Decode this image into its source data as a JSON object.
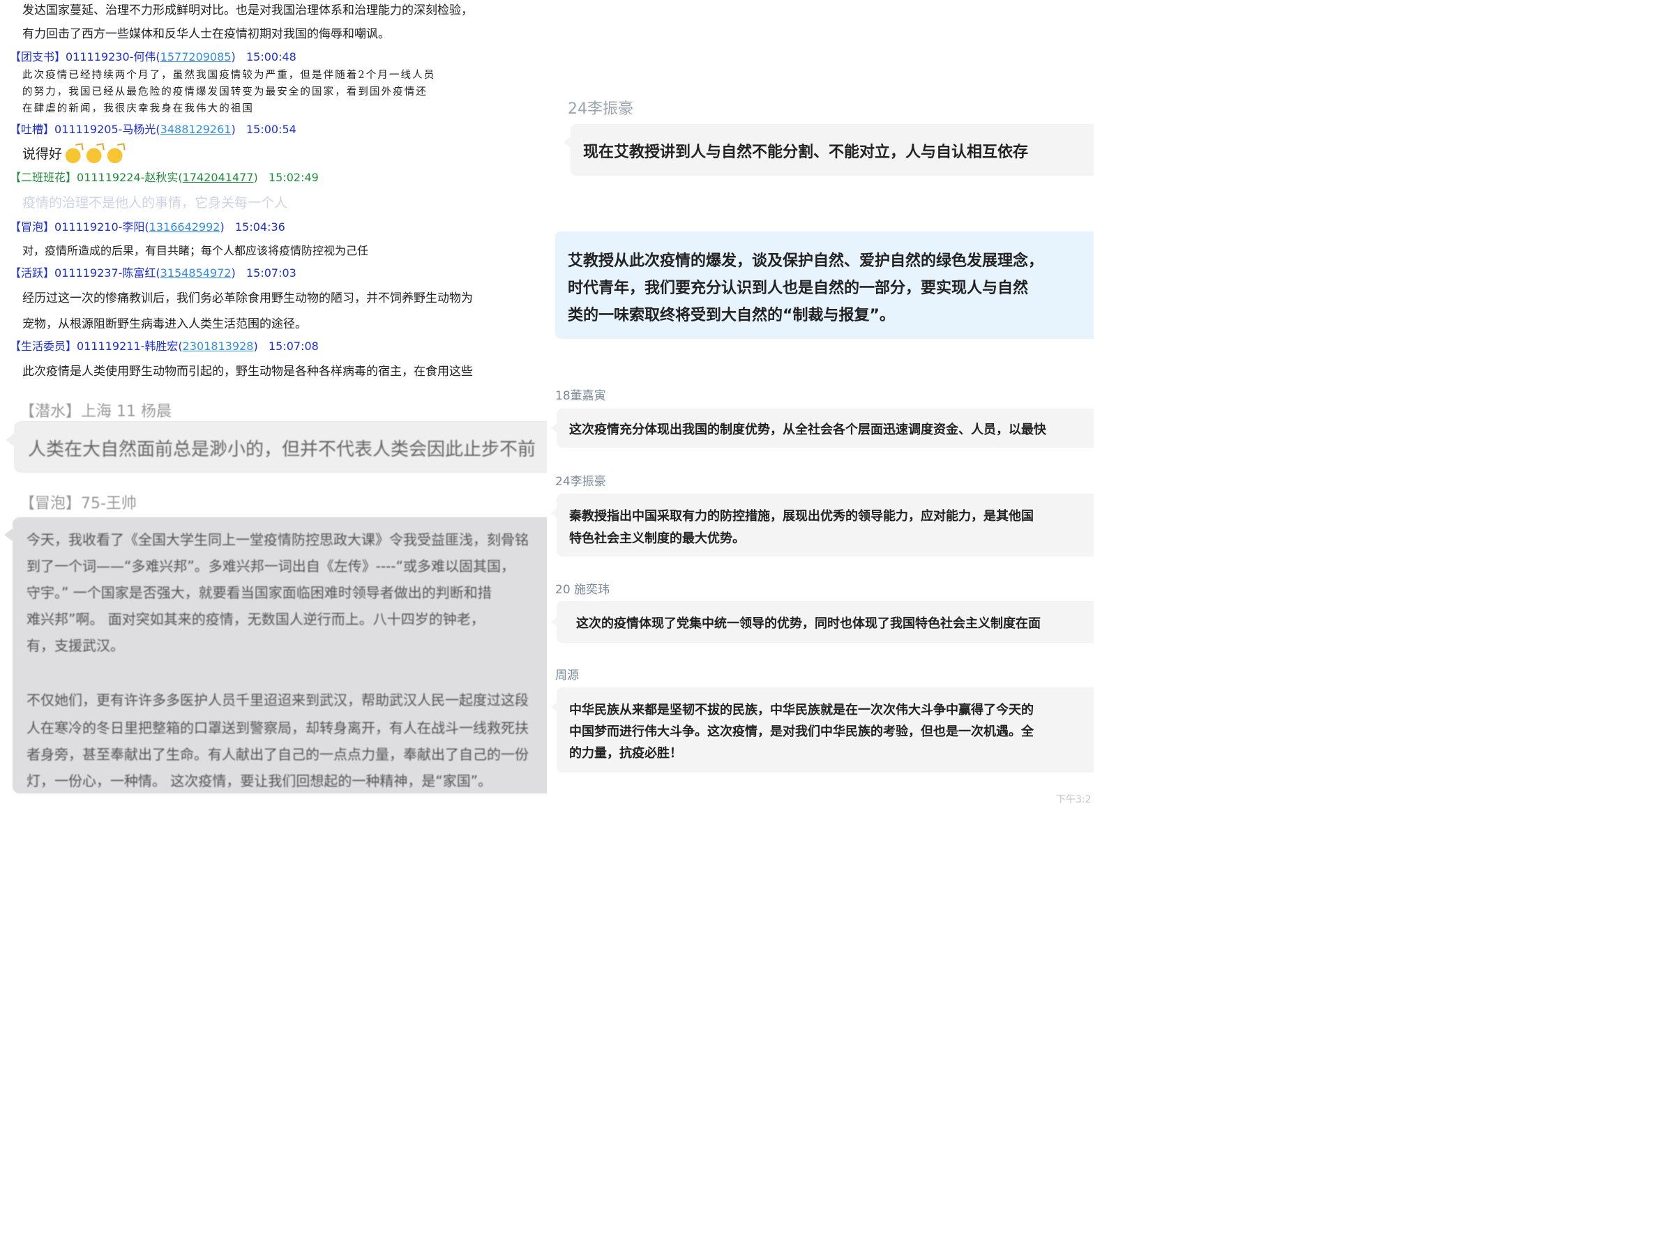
{
  "left_log": {
    "top_lines": [
      "发达国家蔓延、治理不力形成鲜明对比。也是对我国治理体系和治理能力的深刻检验，",
      "有力回击了西方一些媒体和反华人士在疫情初期对我国的侮辱和嘲讽。"
    ],
    "messages": [
      {
        "tag": "【团支书】",
        "id": "011119230-何伟",
        "qq": "1577209085",
        "time": "15:00:48",
        "lines": [
          "此次疫情已经持续两个月了，虽然我国疫情较为严重，但是伴随着2个月一线人员",
          "的努力，我国已经从最危险的疫情爆发国转变为最安全的国家，看到国外疫情还",
          "在肆虐的新闻，我很庆幸我身在我伟大的祖国"
        ]
      },
      {
        "tag": "【吐槽】",
        "id": "011119205-马杨光",
        "qq": "3488129261",
        "time": "15:00:54",
        "lines": [
          "说得好"
        ]
      },
      {
        "tag": "【二班班花】",
        "id": "011119224-赵秋实",
        "qq": "1742041477",
        "time": "15:02:49",
        "lines": [
          "疫情的治理不是他人的事情，它身关每一个人"
        ]
      },
      {
        "tag": "【冒泡】",
        "id": "011119210-李阳",
        "qq": "1316642992",
        "time": "15:04:36",
        "lines": [
          "对，疫情所造成的后果，有目共睹；每个人都应该将疫情防控视为己任"
        ]
      },
      {
        "tag": "【活跃】",
        "id": "011119237-陈富红",
        "qq": "3154854972",
        "time": "15:07:03",
        "lines": [
          "经历过这一次的惨痛教训后，我们务必革除食用野生动物的陋习，并不饲养野生动物为",
          "宠物，从根源阻断野生病毒进入人类生活范围的途径。"
        ]
      },
      {
        "tag": "【生活委员】",
        "id": "011119211-韩胜宏",
        "qq": "2301813928",
        "time": "15:07:08",
        "lines": [
          "此次疫情是人类使用野生动物而引起的，野生动物是各种各样病毒的宿主，在食用这些"
        ]
      }
    ]
  },
  "left_blur": {
    "msg1_header": "【潜水】上海 11 杨晨",
    "msg1_text": "人类在大自然面前总是渺小的，但并不代表人类会因此止步不前",
    "msg2_header": "【冒泡】75-王帅",
    "msg2_lines": [
      "今天，我收看了《全国大学生同上一堂疫情防控思政大课》令我受益匪浅，刻骨铭",
      "到了一个词——“多难兴邦”。多难兴邦一词出自《左传》----“或多难以固其国，",
      "守宇。”      一个国家是否强大，就要看当国家面临困难时领导者做出的判断和措",
      "难兴邦”啊。      面对突如其来的疫情，无数国人逆行而上。八十四岁的钟老，",
      "有，支援武汉。",
      "",
      "不仅她们，更有许许多多医护人员千里迢迢来到武汉，帮助武汉人民一起度过这段",
      "人在寒冷的冬日里把整箱的口罩送到警察局，却转身离开，有人在战斗一线救死扶",
      "者身旁，甚至奉献出了生命。有人献出了自己的一点点力量，奉献出了自己的一份",
      "灯，一份心，一种情。      这次疫情，要让我们回想起的一种精神，是“家国”。"
    ]
  },
  "right_chat": {
    "messages": [
      {
        "name": "24李振豪",
        "text": [
          "现在艾教授讲到人与自然不能分割、不能对立，人与自认相互依存"
        ]
      },
      {
        "name": "",
        "text": [
          "艾教授从此次疫情的爆发，谈及保护自然、爱护自然的绿色发展理念，",
          "时代青年，我们要充分认识到人也是自然的一部分，要实现人与自然",
          "类的一味索取终将受到大自然的“制裁与报复”。"
        ]
      },
      {
        "name": "18董嘉寅",
        "text": [
          "这次疫情充分体现出我国的制度优势，从全社会各个层面迅速调度资金、人员，以最快"
        ]
      },
      {
        "name": "24李振豪",
        "text": [
          "秦教授指出中国采取有力的防控措施，展现出优秀的领导能力，应对能力，是其他国",
          "特色社会主义制度的最大优势。"
        ]
      },
      {
        "name": "20 施奕玮",
        "text": [
          "这次的疫情体现了党集中统一领导的优势，同时也体现了我国特色社会主义制度在面"
        ]
      },
      {
        "name": "周源",
        "text": [
          "中华民族从来都是坚韧不拔的民族，中华民族就是在一次次伟大斗争中赢得了今天的",
          "中国梦而进行伟大斗争。这次疫情，是对我们中华民族的考验，但也是一次机遇。全",
          "的力量，抗疫必胜！"
        ]
      }
    ],
    "time_stamp": "下午3:2"
  }
}
